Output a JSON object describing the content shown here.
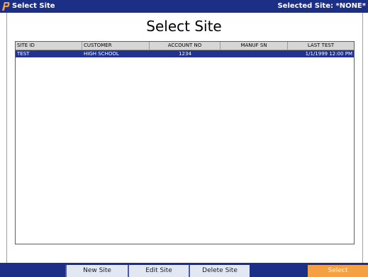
{
  "titlebar": {
    "title": "Select Site",
    "selected_site": "Selected Site: *NONE*"
  },
  "page": {
    "heading": "Select Site"
  },
  "table": {
    "columns": [
      "SITE ID",
      "CUSTOMER",
      "ACCOUNT NO",
      "MANUF SN",
      "LAST TEST"
    ],
    "rows": [
      {
        "site_id": "TEST",
        "customer": "HIGH SCHOOL",
        "account_no": "1234",
        "manuf_sn": "",
        "last_test": "1/1/1999 12:00 PM",
        "selected": true
      }
    ],
    "selection_color": "#21338f"
  },
  "toolbar": {
    "new_site": "New Site",
    "edit_site": "Edit Site",
    "delete_site": "Delete Site",
    "select": "Select"
  },
  "colors": {
    "bar": "#1b2f86",
    "accent": "#f5a043"
  },
  "icons": {
    "app_logo": "p-logo-icon"
  }
}
